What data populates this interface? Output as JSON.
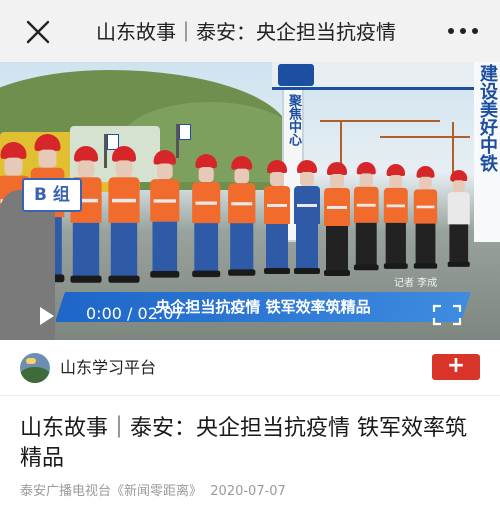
{
  "topbar": {
    "title": "山东故事｜泰安：央企担当抗疫情",
    "close_icon": "close-icon",
    "more_icon": "more-dots-icon"
  },
  "video": {
    "group_sign": "B 组",
    "caption": "央企担当抗疫情  铁军效率筑精品",
    "reporter": "记者 李成",
    "time_current": "0:00",
    "time_separator": "/",
    "time_total": "02:07",
    "play_icon": "play-icon",
    "fullscreen_icon": "fullscreen-icon",
    "gate_left_text": "聚焦中心",
    "gate_right_text": "建设美好中铁"
  },
  "account": {
    "name": "山东学习平台",
    "follow_label": "+",
    "follow_color": "#d8342a"
  },
  "article": {
    "headline": "山东故事｜泰安：央企担当抗疫情  铁军效率筑精品",
    "source": "泰安广播电视台《新闻零距离》",
    "date": "2020-07-07"
  }
}
